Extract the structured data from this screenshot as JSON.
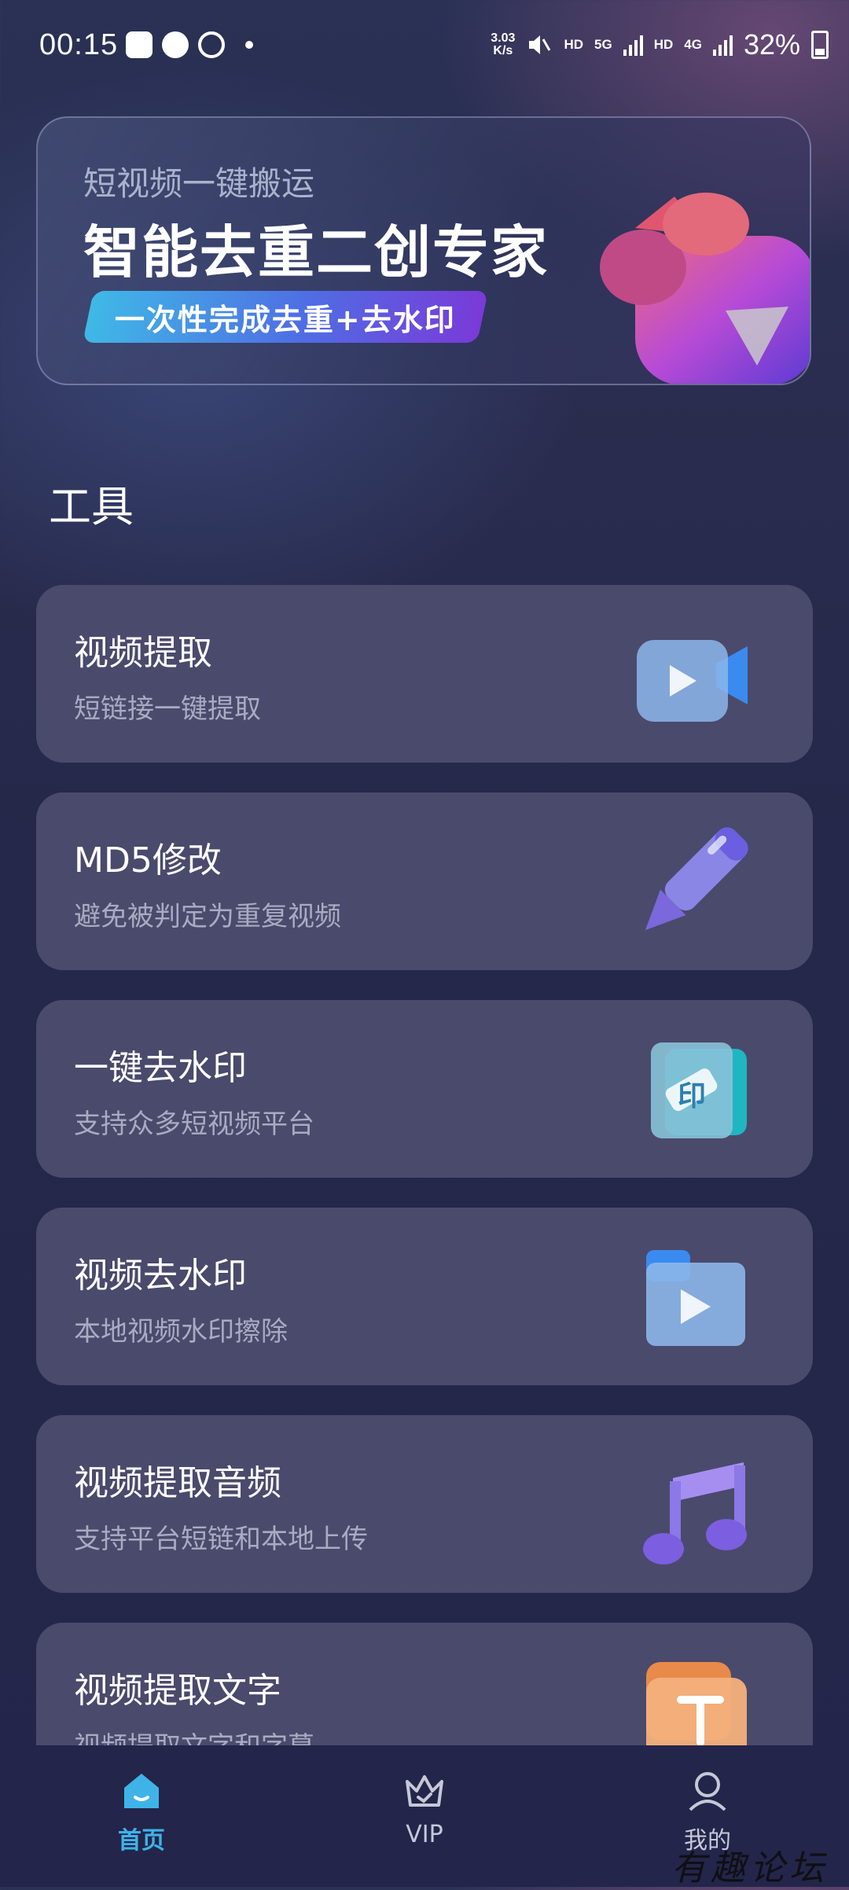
{
  "status_bar": {
    "time": "00:15",
    "speed_value": "3.03",
    "speed_unit": "K/s",
    "hd1": "HD",
    "net1": "5G",
    "hd2": "HD",
    "net2": "4G",
    "battery": "32%"
  },
  "banner": {
    "subtitle": "短视频一键搬运",
    "title": "智能去重二创专家",
    "pill": "一次性完成去重+去水印"
  },
  "section": {
    "title": "工具"
  },
  "tools": [
    {
      "title": "视频提取",
      "subtitle": "短链接一键提取",
      "icon": "video-camera-icon"
    },
    {
      "title": "MD5修改",
      "subtitle": "避免被判定为重复视频",
      "icon": "pencil-icon"
    },
    {
      "title": "一键去水印",
      "subtitle": "支持众多短视频平台",
      "icon": "watermark-stamp-icon"
    },
    {
      "title": "视频去水印",
      "subtitle": "本地视频水印擦除",
      "icon": "video-folder-icon"
    },
    {
      "title": "视频提取音频",
      "subtitle": "支持平台短链和本地上传",
      "icon": "music-note-icon"
    },
    {
      "title": "视频提取文字",
      "subtitle": "视频提取文字和字幕",
      "icon": "text-icon"
    }
  ],
  "tabbar": {
    "home": "首页",
    "vip": "VIP",
    "me": "我的"
  },
  "watermark": "有趣论坛",
  "colors": {
    "accent": "#3fb3e8",
    "card": "#4a4a6c",
    "background": "#25284a"
  }
}
